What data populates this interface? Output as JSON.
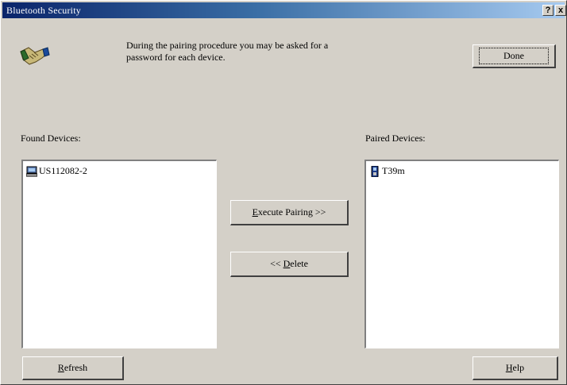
{
  "window": {
    "title": "Bluetooth Security",
    "help_glyph": "?",
    "close_glyph": "x"
  },
  "intro": {
    "text_line1": "During the pairing procedure you may be asked for a",
    "text_line2": "password for each device."
  },
  "buttons": {
    "done_label": "Done",
    "execute_pairing": {
      "mnemonic": "E",
      "rest": "xecute Pairing >>"
    },
    "delete": {
      "prefix": "<< ",
      "mnemonic": "D",
      "rest": "elete"
    },
    "refresh": {
      "mnemonic": "R",
      "rest": "efresh"
    },
    "help": {
      "mnemonic": "H",
      "rest": "elp"
    }
  },
  "found_devices": {
    "label": "Found Devices:",
    "items": [
      {
        "name": "US112082-2",
        "icon": "computer-icon"
      }
    ]
  },
  "paired_devices": {
    "label": "Paired Devices:",
    "items": [
      {
        "name": "T39m",
        "icon": "phone-icon"
      }
    ]
  },
  "colors": {
    "dialog_face": "#d4d0c8",
    "titlebar_start": "#0a246a",
    "titlebar_end": "#a6caf0",
    "listbox_bg": "#ffffff"
  }
}
